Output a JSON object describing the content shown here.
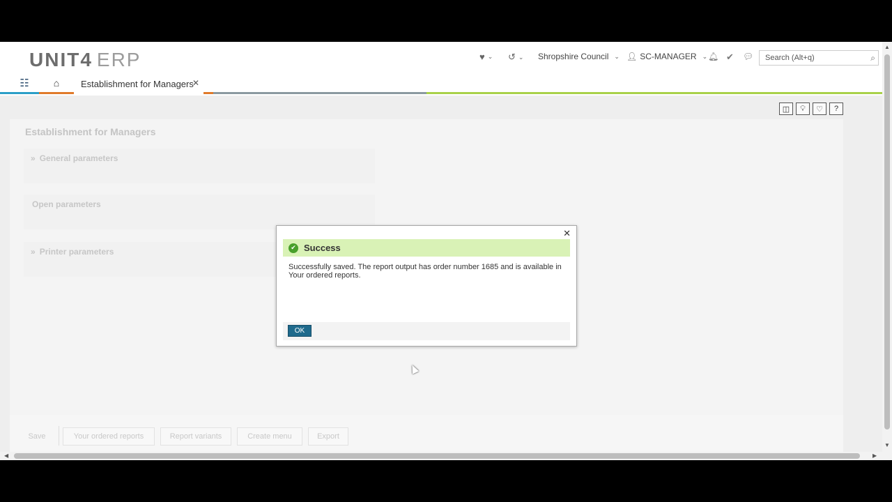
{
  "header": {
    "logo_unit": "UNIT4",
    "logo_erp": "ERP",
    "company": "Shropshire Council",
    "user": "SC-MANAGER",
    "search_placeholder": "Search (Alt+q)"
  },
  "tabs": {
    "active_label": "Establishment for Managers"
  },
  "form": {
    "title": "Establishment for Managers",
    "sections": {
      "general": "General parameters",
      "open": "Open parameters",
      "printer": "Printer parameters"
    },
    "buttons": {
      "save": "Save",
      "ordered_reports": "Your ordered reports",
      "report_variants": "Report variants",
      "create_menu": "Create menu",
      "export": "Export"
    }
  },
  "dialog": {
    "title": "Success",
    "message": "Successfully saved. The report output has order number 1685 and is available in Your ordered reports.",
    "ok_label": "OK"
  },
  "colors": {
    "success_header": "#d9f2b6",
    "ok_button": "#1f6a8c",
    "accent_green": "#a9d14a",
    "accent_orange": "#e07a2a",
    "accent_blue": "#2b9ec7"
  }
}
